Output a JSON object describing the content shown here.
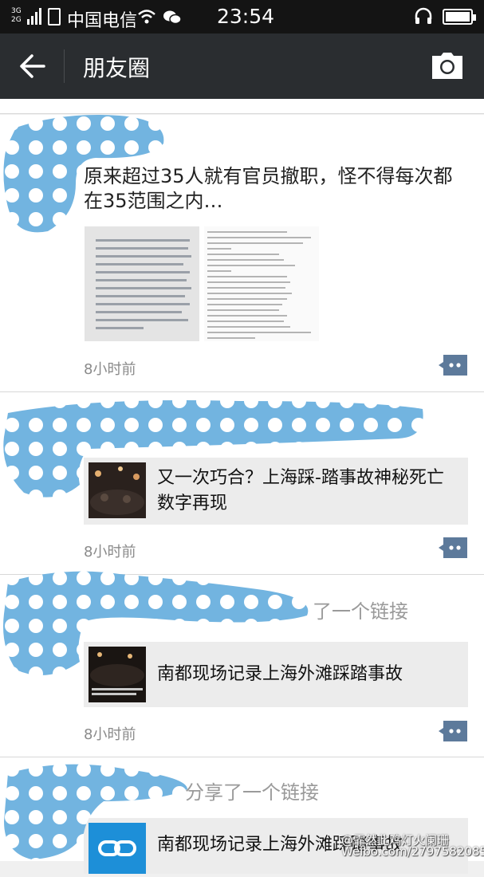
{
  "status_bar": {
    "network": "3G\n2G",
    "carrier": "中国电信",
    "time": "23:54"
  },
  "title_bar": {
    "title": "朋友圈",
    "back_icon": "back-arrow-icon",
    "camera_icon": "camera-icon"
  },
  "posts": [
    {
      "text": "原来超过35人就有官员撤职，怪不得每次都在35范围之内…",
      "time": "8小时前"
    },
    {
      "link_title": "又一次巧合？上海踩-踏事故神秘死亡数字再现",
      "time": "8小时前"
    },
    {
      "share_text": "了一个链接",
      "link_title": "南都现场记录上海外滩踩踏事故",
      "time": "8小时前"
    },
    {
      "share_text": "分享了一个链接",
      "link_title": "南都现场记录上海外滩踩踏事故"
    }
  ],
  "watermark": "@霏然此鸡灯火阑珊\nWeibo.com/2797582085"
}
